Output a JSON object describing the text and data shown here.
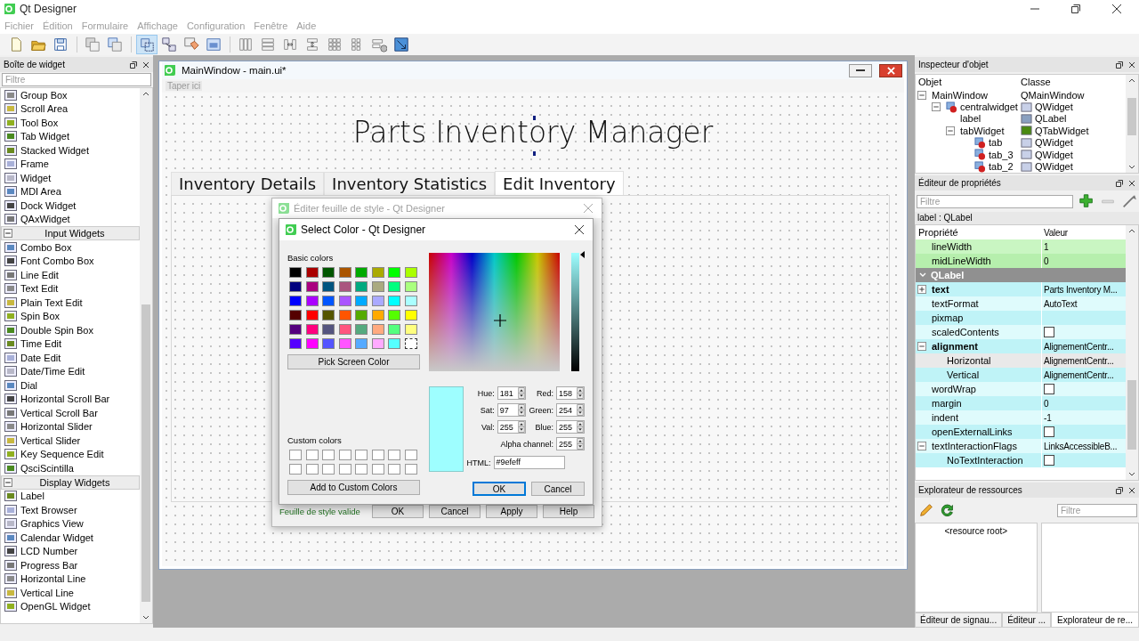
{
  "app": {
    "title": "Qt Designer"
  },
  "menu": [
    {
      "label": "Fichier",
      "disabled": true
    },
    {
      "label": "Édition",
      "disabled": true
    },
    {
      "label": "Formulaire",
      "disabled": true
    },
    {
      "label": "Affichage",
      "disabled": true
    },
    {
      "label": "Configuration",
      "disabled": true
    },
    {
      "label": "Fenêtre",
      "disabled": true
    },
    {
      "label": "Aide",
      "disabled": true
    }
  ],
  "toolbar_groups": [
    [
      {
        "selected": false
      },
      {
        "selected": false
      },
      {
        "selected": false
      }
    ],
    [
      {
        "selected": false
      },
      {
        "selected": false
      }
    ],
    [
      {
        "selected": true
      },
      {
        "selected": false
      },
      {
        "selected": false
      },
      {
        "selected": false
      }
    ],
    [
      {
        "selected": false
      },
      {
        "selected": false
      },
      {
        "selected": false
      },
      {
        "selected": false
      },
      {
        "selected": false
      },
      {
        "selected": false
      },
      {
        "selected": false
      },
      {
        "selected": false
      }
    ]
  ],
  "widget_box": {
    "title": "Boîte de widget",
    "filter_placeholder": "Filtre",
    "sections": [
      {
        "items": [
          "Group Box",
          "Scroll Area",
          "Tool Box",
          "Tab Widget",
          "Stacked Widget",
          "Frame",
          "Widget",
          "MDI Area",
          "Dock Widget",
          "QAxWidget"
        ]
      },
      {
        "title": "Input Widgets",
        "expanded": true,
        "items": [
          "Combo Box",
          "Font Combo Box",
          "Line Edit",
          "Text Edit",
          "Plain Text Edit",
          "Spin Box",
          "Double Spin Box",
          "Time Edit",
          "Date Edit",
          "Date/Time Edit",
          "Dial",
          "Horizontal Scroll Bar",
          "Vertical Scroll Bar",
          "Horizontal Slider",
          "Vertical Slider",
          "Key Sequence Edit",
          "QsciScintilla"
        ]
      },
      {
        "title": "Display Widgets",
        "expanded": true,
        "items": [
          "Label",
          "Text Browser",
          "Graphics View",
          "Calendar Widget",
          "LCD Number",
          "Progress Bar",
          "Horizontal Line",
          "Vertical Line",
          "OpenGL Widget"
        ]
      }
    ]
  },
  "form_window": {
    "title": "MainWindow - main.ui*",
    "menu_placeholder": "Taper ici",
    "label": "Parts Inventory Manager",
    "tabs": [
      {
        "label": "Inventory Details",
        "selected": false
      },
      {
        "label": "Inventory Statistics",
        "selected": false
      },
      {
        "label": "Edit Inventory",
        "selected": true
      }
    ]
  },
  "stylesheet_dialog": {
    "title": "Éditer feuille de style - Qt Designer",
    "status": "Feuille de style valide",
    "buttons": [
      "OK",
      "Cancel",
      "Apply",
      "Help"
    ]
  },
  "color_dialog": {
    "title": "Select Color - Qt Designer",
    "basic_label": "Basic colors",
    "basic_colors": [
      {
        "color": "#000000",
        "selected": false
      },
      {
        "color": "#aa0000",
        "selected": false
      },
      {
        "color": "#005500",
        "selected": false
      },
      {
        "color": "#aa5500",
        "selected": false
      },
      {
        "color": "#00aa00",
        "selected": false
      },
      {
        "color": "#aaaa00",
        "selected": false
      },
      {
        "color": "#00ff00",
        "selected": false
      },
      {
        "color": "#aaff00",
        "selected": false
      },
      {
        "color": "#00007f",
        "selected": false
      },
      {
        "color": "#aa007f",
        "selected": false
      },
      {
        "color": "#00557f",
        "selected": false
      },
      {
        "color": "#aa557f",
        "selected": false
      },
      {
        "color": "#00aa7f",
        "selected": false
      },
      {
        "color": "#aaaa7f",
        "selected": false
      },
      {
        "color": "#00ff7f",
        "selected": false
      },
      {
        "color": "#aaff7f",
        "selected": false
      },
      {
        "color": "#0000ff",
        "selected": false
      },
      {
        "color": "#aa00ff",
        "selected": false
      },
      {
        "color": "#0055ff",
        "selected": false
      },
      {
        "color": "#aa55ff",
        "selected": false
      },
      {
        "color": "#00aaff",
        "selected": false
      },
      {
        "color": "#aaaaff",
        "selected": false
      },
      {
        "color": "#00ffff",
        "selected": false
      },
      {
        "color": "#aaffff",
        "selected": false
      },
      {
        "color": "#550000",
        "selected": false
      },
      {
        "color": "#ff0000",
        "selected": false
      },
      {
        "color": "#555500",
        "selected": false
      },
      {
        "color": "#ff5500",
        "selected": false
      },
      {
        "color": "#55aa00",
        "selected": false
      },
      {
        "color": "#ffaa00",
        "selected": false
      },
      {
        "color": "#55ff00",
        "selected": false
      },
      {
        "color": "#ffff00",
        "selected": false
      },
      {
        "color": "#55007f",
        "selected": false
      },
      {
        "color": "#ff007f",
        "selected": false
      },
      {
        "color": "#55557f",
        "selected": false
      },
      {
        "color": "#ff557f",
        "selected": false
      },
      {
        "color": "#55aa7f",
        "selected": false
      },
      {
        "color": "#ffaa7f",
        "selected": false
      },
      {
        "color": "#55ff7f",
        "selected": false
      },
      {
        "color": "#ffff7f",
        "selected": false
      },
      {
        "color": "#5500ff",
        "selected": false
      },
      {
        "color": "#ff00ff",
        "selected": false
      },
      {
        "color": "#5555ff",
        "selected": false
      },
      {
        "color": "#ff55ff",
        "selected": false
      },
      {
        "color": "#55aaff",
        "selected": false
      },
      {
        "color": "#ffaaff",
        "selected": false
      },
      {
        "color": "#55ffff",
        "selected": false
      },
      {
        "color": "#ffffff",
        "selected": true
      }
    ],
    "pick_button": "Pick Screen Color",
    "custom_label": "Custom colors",
    "custom_colors": [
      {
        "color": "#ffffff"
      },
      {
        "color": "#ffffff"
      },
      {
        "color": "#ffffff"
      },
      {
        "color": "#ffffff"
      },
      {
        "color": "#ffffff"
      },
      {
        "color": "#ffffff"
      },
      {
        "color": "#ffffff"
      },
      {
        "color": "#ffffff"
      },
      {
        "color": "#ffffff"
      },
      {
        "color": "#ffffff"
      },
      {
        "color": "#ffffff"
      },
      {
        "color": "#ffffff"
      },
      {
        "color": "#ffffff"
      },
      {
        "color": "#ffffff"
      },
      {
        "color": "#ffffff"
      },
      {
        "color": "#ffffff"
      }
    ],
    "add_button": "Add to Custom Colors",
    "preview": {
      "color": "#9efeff"
    },
    "value_slider": {
      "level": 1
    },
    "fields": [
      {
        "label": "Hue:",
        "value": "181"
      },
      {
        "label": "Red:",
        "value": "158"
      },
      {
        "label": "Sat:",
        "value": "97"
      },
      {
        "label": "Green:",
        "value": "254"
      },
      {
        "label": "Val:",
        "value": "255"
      },
      {
        "label": "Blue:",
        "value": "255"
      },
      {
        "label": "Alpha channel:",
        "value": "255"
      }
    ],
    "html": {
      "label": "HTML:",
      "value": "#9efeff"
    },
    "buttons": [
      {
        "label": "OK",
        "default": true
      },
      {
        "label": "Cancel",
        "default": false
      }
    ]
  },
  "object_inspector": {
    "title": "Inspecteur d'objet",
    "columns": [
      "Objet",
      "Classe"
    ],
    "tree": [
      {
        "name": "MainWindow",
        "class": "QMainWindow",
        "kind": "main_window",
        "broken_layout": false,
        "expanded": true,
        "children": [
          {
            "name": "centralwidget",
            "class": "QWidget",
            "kind": "widget",
            "broken_layout": true,
            "expanded": true,
            "children": [
              {
                "name": "label",
                "class": "QLabel",
                "kind": "label",
                "broken_layout": false
              },
              {
                "name": "tabWidget",
                "class": "QTabWidget",
                "kind": "tab_widget",
                "broken_layout": false,
                "expanded": true,
                "children": [
                  {
                    "name": "tab",
                    "class": "QWidget",
                    "kind": "widget",
                    "broken_layout": true
                  },
                  {
                    "name": "tab_3",
                    "class": "QWidget",
                    "kind": "widget",
                    "broken_layout": true
                  },
                  {
                    "name": "tab_2",
                    "class": "QWidget",
                    "kind": "widget",
                    "broken_layout": true
                  }
                ]
              }
            ]
          }
        ]
      }
    ]
  },
  "property_editor": {
    "title": "Éditeur de propriétés",
    "filter_placeholder": "Filtre",
    "object": "label : QLabel",
    "columns": [
      "Propriété",
      "Valeur"
    ],
    "properties": [
      {
        "kind": "text",
        "name": "lineWidth",
        "value": "1",
        "color": "#c9f6c2",
        "bold": false
      },
      {
        "kind": "text",
        "name": "midLineWidth",
        "value": "0",
        "color": "#b6efad",
        "bold": false
      },
      {
        "kind": "group",
        "name": "QLabel",
        "expanded": true,
        "children": [
          {
            "kind": "text",
            "name": "text",
            "value": "Parts Inventory M...",
            "color": "#bff3f7",
            "bold": true,
            "expanded": false
          },
          {
            "kind": "text",
            "name": "textFormat",
            "value": "AutoText",
            "color": "#dffbfc",
            "bold": false
          },
          {
            "kind": "text",
            "name": "pixmap",
            "color": "#bff3f7",
            "bold": false
          },
          {
            "kind": "checkbox",
            "name": "scaledContents",
            "checked": false,
            "color": "#dffbfc",
            "bold": false
          },
          {
            "kind": "text",
            "name": "alignment",
            "value": "AlignementCentr...",
            "color": "#bff3f7",
            "bold": true,
            "expanded": true,
            "children": [
              {
                "kind": "text",
                "name": "Horizontal",
                "value": "AlignementCentr...",
                "color": "#e9e9e9",
                "bold": false
              },
              {
                "kind": "text",
                "name": "Vertical",
                "value": "AlignementCentr...",
                "color": "#bff3f7",
                "bold": false
              }
            ]
          },
          {
            "kind": "checkbox",
            "name": "wordWrap",
            "checked": false,
            "color": "#dffbfc",
            "bold": false
          },
          {
            "kind": "text",
            "name": "margin",
            "value": "0",
            "color": "#bff3f7",
            "bold": false
          },
          {
            "kind": "text",
            "name": "indent",
            "value": "-1",
            "color": "#dffbfc",
            "bold": false
          },
          {
            "kind": "checkbox",
            "name": "openExternalLinks",
            "checked": false,
            "color": "#bff3f7",
            "bold": false
          },
          {
            "kind": "text",
            "name": "textInteractionFlags",
            "value": "LinksAccessibleB...",
            "color": "#dffbfc",
            "bold": false,
            "expanded": true,
            "children": [
              {
                "kind": "checkbox",
                "name": "NoTextInteraction",
                "checked": false,
                "color": "#bff3f7",
                "bold": false
              }
            ]
          }
        ]
      }
    ]
  },
  "resource_browser": {
    "title": "Explorateur de ressources",
    "filter_placeholder": "Filtre",
    "root": "<resource root>"
  },
  "bottom_tabs": [
    {
      "label": "Éditeur de signau...",
      "selected": false
    },
    {
      "label": "Éditeur ...",
      "selected": false
    },
    {
      "label": "Explorateur de re...",
      "selected": true
    }
  ]
}
